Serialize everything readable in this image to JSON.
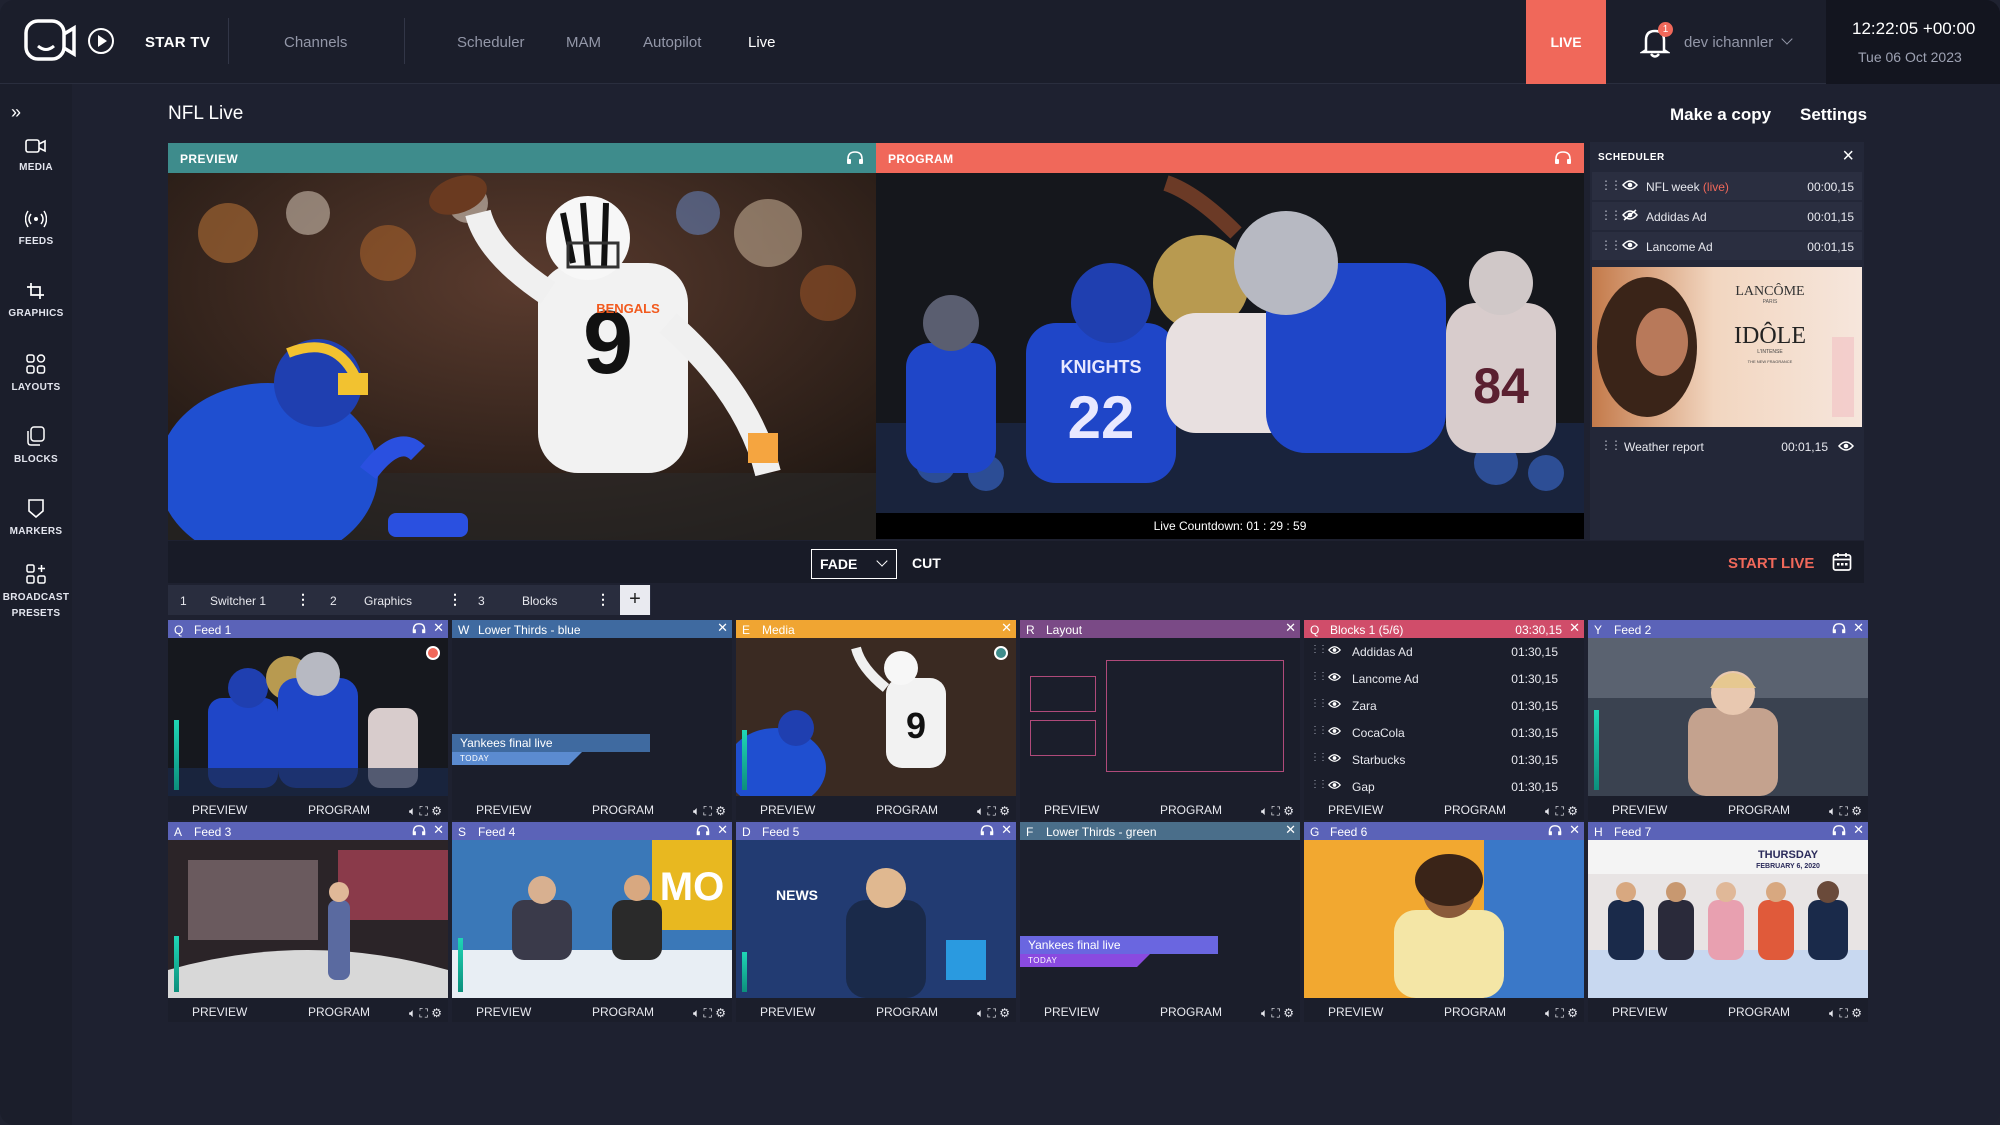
{
  "header": {
    "brand": "STAR TV",
    "nav": [
      "Channels",
      "Scheduler",
      "MAM",
      "Autopilot",
      "Live"
    ],
    "active_nav": "Live",
    "live_button": "LIVE",
    "notification_count": "1",
    "user": "dev ichannler",
    "clock_time": "12:22:05 +00:00",
    "clock_date": "Tue 06 Oct 2023"
  },
  "sidebar": {
    "items": [
      {
        "label": "MEDIA",
        "icon": "camera-icon"
      },
      {
        "label": "FEEDS",
        "icon": "broadcast-icon"
      },
      {
        "label": "GRAPHICS",
        "icon": "crop-icon"
      },
      {
        "label": "LAYOUTS",
        "icon": "layout-grid-icon"
      },
      {
        "label": "BLOCKS",
        "icon": "blocks-icon"
      },
      {
        "label": "MARKERS",
        "icon": "marker-icon"
      },
      {
        "label": "BROADCAST",
        "label2": "PRESETS",
        "icon": "add-grid-icon"
      }
    ]
  },
  "main": {
    "title": "NFL Live",
    "make_copy": "Make a copy",
    "settings": "Settings",
    "preview_label": "PREVIEW",
    "program_label": "PROGRAM",
    "countdown": "Live Countdown: 01 : 29 : 59",
    "preview_jersey": "BENGALS",
    "program_jersey": "KNIGHTS"
  },
  "scheduler": {
    "title": "SCHEDULER",
    "items": [
      {
        "name": "NFL week",
        "tag": "(live)",
        "time": "00:00,15",
        "eye": "eye-icon"
      },
      {
        "name": "Addidas Ad",
        "tag": "",
        "time": "00:01,15",
        "eye": "eye-off-icon"
      },
      {
        "name": "Lancome Ad",
        "tag": "",
        "time": "00:01,15",
        "eye": "eye-icon"
      }
    ],
    "ad_brand": "LANCÔME",
    "ad_sub": "PARIS",
    "ad_product": "IDÔLE",
    "ad_tag": "L'INTENSE",
    "ad_line": "THE NEW FRAGRANCE",
    "last_item": {
      "name": "Weather report",
      "time": "00:01,15"
    }
  },
  "transport": {
    "fade": "FADE",
    "cut": "CUT",
    "start_live": "START LIVE"
  },
  "tabs": [
    {
      "num": "1",
      "label": "Switcher 1"
    },
    {
      "num": "2",
      "label": "Graphics"
    },
    {
      "num": "3",
      "label": "Blocks"
    }
  ],
  "tile_footer": {
    "preview": "PREVIEW",
    "program": "PROGRAM"
  },
  "tiles": [
    {
      "key": "Q",
      "title": "Feed 1",
      "color": "#5b63b8"
    },
    {
      "key": "W",
      "title": "Lower Thirds - blue",
      "color": "#3f6aa0",
      "lower": "Yankees final live",
      "sub": "TODAY"
    },
    {
      "key": "E",
      "title": "Media",
      "color": "#f0a532"
    },
    {
      "key": "R",
      "title": "Layout",
      "color": "#7a4a86"
    },
    {
      "key": "Q",
      "title": "Blocks 1 (5/6)",
      "duration": "03:30,15",
      "color": "#d04d6a"
    },
    {
      "key": "Y",
      "title": "Feed 2",
      "color": "#5b63b8"
    },
    {
      "key": "A",
      "title": "Feed 3",
      "color": "#5b63b8"
    },
    {
      "key": "S",
      "title": "Feed 4",
      "color": "#5b63b8"
    },
    {
      "key": "D",
      "title": "Feed 5",
      "color": "#5b63b8"
    },
    {
      "key": "F",
      "title": "Lower Thirds - green",
      "color": "#4a6e8a",
      "lower": "Yankees final live",
      "sub": "TODAY"
    },
    {
      "key": "G",
      "title": "Feed 6",
      "color": "#5b63b8"
    },
    {
      "key": "H",
      "title": "Feed 7",
      "color": "#5b63b8"
    }
  ],
  "blocks": [
    {
      "name": "Addidas Ad",
      "time": "01:30,15"
    },
    {
      "name": "Lancome Ad",
      "time": "01:30,15"
    },
    {
      "name": "Zara",
      "time": "01:30,15"
    },
    {
      "name": "CocaCola",
      "time": "01:30,15"
    },
    {
      "name": "Starbucks",
      "time": "01:30,15"
    },
    {
      "name": "Gap",
      "time": "01:30,15"
    }
  ],
  "feed7_banner": "THURSDAY",
  "feed7_date": "FEBRUARY 6, 2020",
  "feed4_sign": "MO",
  "feed5_sign": "NEWS",
  "colors": {
    "live": "#f0685a",
    "preview": "#3e8c8c",
    "program": "#f0685a",
    "bg": "#1e2130"
  }
}
